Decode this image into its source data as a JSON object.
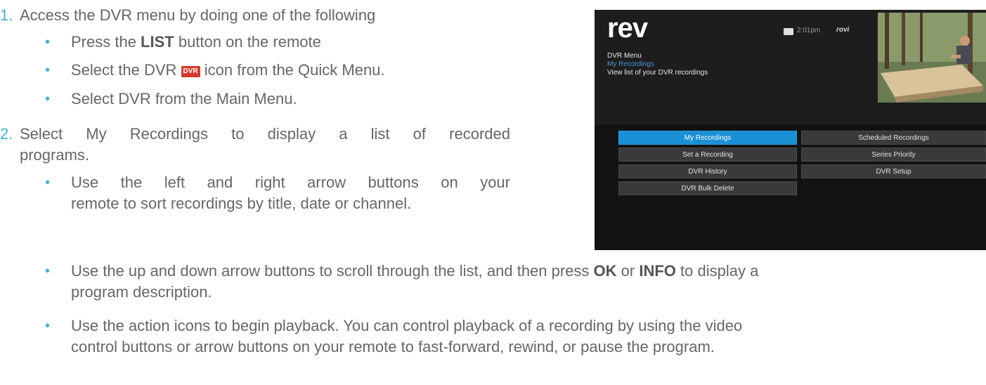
{
  "steps": [
    {
      "number": "1.",
      "text": "Access the DVR menu by doing one of the following",
      "bullets": {
        "b1": {
          "pre": "Press the ",
          "bold": "LIST",
          "post": " button on the remote"
        },
        "b2": {
          "pre": "Select the DVR ",
          "badge": "DVR",
          "post": " icon from the Quick Menu."
        },
        "b3": {
          "text": "Select DVR from the Main Menu."
        }
      }
    },
    {
      "number": "2.",
      "text_line1": "Select My Recordings to display a list of recorded",
      "text_line2": "programs.",
      "bullets": {
        "b1": {
          "line1": "Use the left and right arrow buttons on your",
          "line2": "remote to sort recordings by title, date or channel."
        },
        "b2": {
          "line1_pre": "Use the up and down arrow buttons to scroll through the list, and then press ",
          "bold1": "OK",
          "mid": " or ",
          "bold2": "INFO",
          "line1_post": " to display a",
          "line2": "program description."
        },
        "b3": {
          "line1": "Use the action icons to begin playback. You can control playback of a recording by using the video",
          "line2": "control buttons or arrow buttons on your remote to fast-forward, rewind, or pause the program."
        }
      }
    }
  ],
  "bullet_glyph": "•",
  "tv": {
    "logo": "rev",
    "time": "2:01pm",
    "brand": "rovi",
    "menu_title": "DVR Menu",
    "breadcrumb": "My Recordings",
    "description": "View list of your DVR recordings",
    "buttons_left": [
      "My Recordings",
      "Set a Recording",
      "DVR History",
      "DVR Bulk Delete"
    ],
    "buttons_right": [
      "Scheduled Recordings",
      "Series Priority",
      "DVR Setup"
    ],
    "selected": "My Recordings",
    "accent_color": "#1a8fd4"
  },
  "colors": {
    "list_number": "#4ab0c8",
    "body_text": "#666666"
  }
}
